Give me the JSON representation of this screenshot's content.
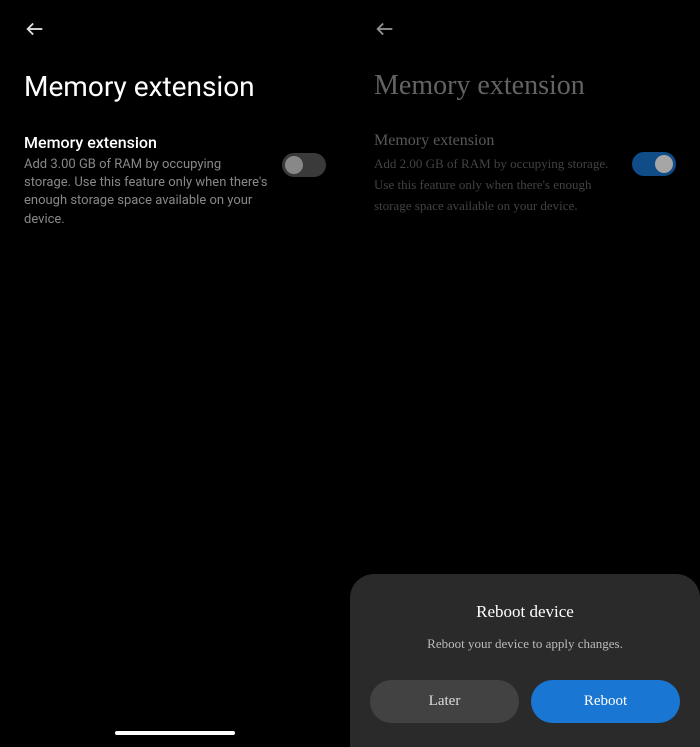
{
  "left": {
    "page_title": "Memory extension",
    "setting": {
      "title": "Memory extension",
      "description": "Add 3.00 GB of RAM by occupying storage. Use this feature only when there's enough storage space available on your device.",
      "enabled": false
    }
  },
  "right": {
    "page_title": "Memory extension",
    "setting": {
      "title": "Memory extension",
      "description": "Add 2.00 GB of RAM by occupying storage. Use this feature only when there's enough storage space available on your device.",
      "enabled": true
    }
  },
  "dialog": {
    "title": "Reboot device",
    "message": "Reboot your device to apply changes.",
    "later_label": "Later",
    "reboot_label": "Reboot"
  }
}
